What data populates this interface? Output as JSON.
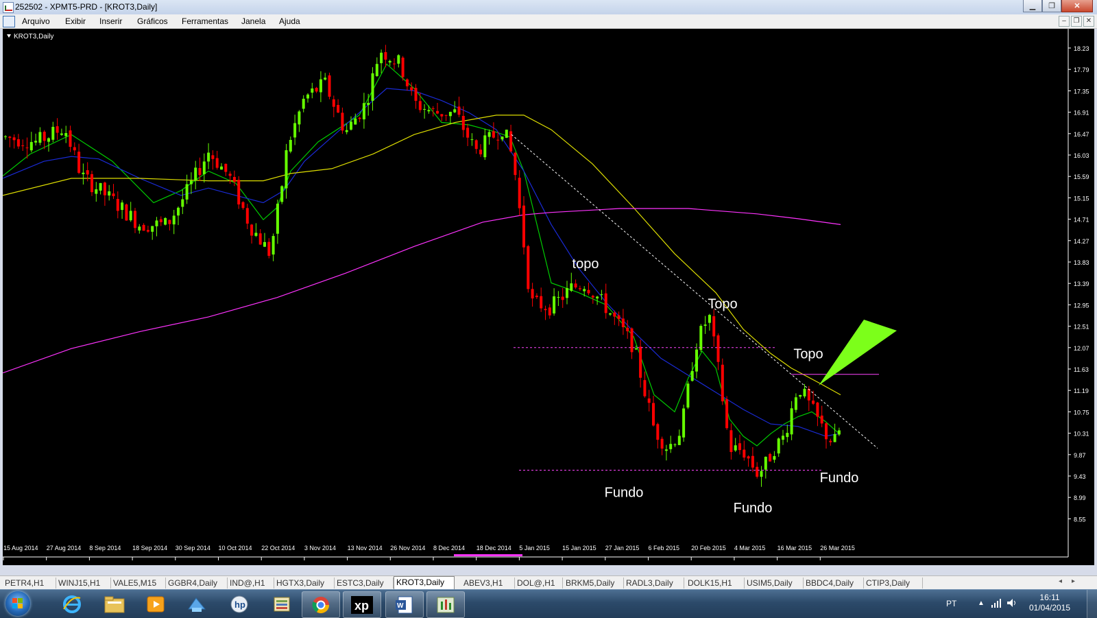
{
  "window": {
    "title": "252502 - XPMT5-PRD - [KROT3,Daily]"
  },
  "menu": {
    "items": [
      "Arquivo",
      "Exibir",
      "Inserir",
      "Gráficos",
      "Ferramentas",
      "Janela",
      "Ajuda"
    ]
  },
  "chart_panel": {
    "label": "KROT3,Daily"
  },
  "chart_data": {
    "type": "candlestick",
    "symbol": "KROT3",
    "timeframe": "Daily",
    "ylim": [
      8.33,
      18.45
    ],
    "price_ticks": [
      "18.23",
      "17.79",
      "17.35",
      "16.91",
      "16.47",
      "16.03",
      "15.59",
      "15.15",
      "14.71",
      "14.27",
      "13.83",
      "13.39",
      "12.95",
      "12.51",
      "12.07",
      "11.63",
      "11.19",
      "10.75",
      "10.31",
      "9.87",
      "9.43",
      "8.99",
      "8.55"
    ],
    "date_ticks": [
      "15 Aug 2014",
      "27 Aug 2014",
      "8 Sep 2014",
      "18 Sep 2014",
      "30 Sep 2014",
      "10 Oct 2014",
      "22 Oct 2014",
      "3 Nov 2014",
      "13 Nov 2014",
      "26 Nov 2014",
      "8 Dec 2014",
      "18 Dec 2014",
      "5 Jan 2015",
      "15 Jan 2015",
      "27 Jan 2015",
      "6 Feb 2015",
      "20 Feb 2015",
      "4 Mar 2015",
      "16 Mar 2015",
      "26 Mar 2015"
    ],
    "colors": {
      "background": "#000000",
      "up": "#66ff00",
      "down": "#ff0000",
      "ma_fast": "#00cc00",
      "ma_mid": "#1a2bd6",
      "ma_slow": "#dede00",
      "ma_long": "#ff33ff",
      "trend": "#ffffff",
      "support": "#ff44ff",
      "arrow": "#7cff1a"
    },
    "series": [
      {
        "name": "",
        "type": "moving_average",
        "color": "#00cc00",
        "x": [
          0,
          40,
          100,
          160,
          220,
          260,
          300,
          340,
          380,
          400,
          420,
          460,
          520,
          560,
          600,
          640,
          680,
          720,
          740,
          760,
          800,
          840,
          880,
          920,
          950,
          980,
          1000,
          1020,
          1040,
          1060,
          1080,
          1100,
          1120,
          1140,
          1160,
          1180,
          1200,
          1220
        ],
        "y": [
          15.6,
          16.05,
          16.45,
          15.9,
          15.05,
          15.3,
          15.7,
          15.45,
          14.7,
          14.95,
          15.7,
          16.3,
          16.85,
          17.9,
          17.4,
          16.7,
          16.65,
          16.5,
          16.4,
          15.7,
          13.4,
          13.2,
          12.95,
          12.3,
          11.1,
          10.75,
          11.45,
          12.0,
          11.65,
          10.6,
          10.25,
          10.05,
          10.3,
          10.5,
          10.65,
          10.75,
          10.55,
          10.3
        ]
      },
      {
        "name": "",
        "type": "moving_average",
        "color": "#1a2bd6",
        "x": [
          0,
          60,
          100,
          140,
          200,
          260,
          300,
          340,
          380,
          410,
          440,
          480,
          520,
          560,
          600,
          640,
          680,
          720,
          760,
          800,
          840,
          880,
          920,
          960,
          1000,
          1040,
          1080,
          1120,
          1160,
          1200,
          1220
        ],
        "y": [
          15.55,
          15.9,
          16.0,
          15.95,
          15.55,
          15.2,
          15.35,
          15.2,
          15.05,
          15.3,
          15.9,
          16.4,
          16.9,
          17.4,
          17.35,
          17.15,
          16.9,
          16.55,
          15.7,
          14.6,
          13.7,
          13.0,
          12.4,
          11.85,
          11.5,
          11.15,
          10.8,
          10.5,
          10.45,
          10.25,
          10.3
        ]
      },
      {
        "name": "",
        "type": "moving_average",
        "color": "#dede00",
        "x": [
          0,
          100,
          200,
          300,
          380,
          420,
          480,
          540,
          600,
          660,
          720,
          760,
          800,
          860,
          920,
          980,
          1040,
          1080,
          1120,
          1150,
          1190,
          1222
        ],
        "y": [
          15.2,
          15.55,
          15.55,
          15.5,
          15.5,
          15.65,
          15.75,
          16.05,
          16.45,
          16.7,
          16.85,
          16.85,
          16.55,
          15.85,
          14.95,
          14.0,
          13.2,
          12.45,
          11.95,
          11.65,
          11.35,
          11.1
        ]
      },
      {
        "name": "",
        "type": "moving_average",
        "color": "#ff33ff",
        "x": [
          0,
          100,
          200,
          300,
          400,
          500,
          600,
          700,
          760,
          800,
          900,
          1000,
          1100,
          1160,
          1222
        ],
        "y": [
          11.55,
          12.05,
          12.4,
          12.7,
          13.1,
          13.6,
          14.15,
          14.65,
          14.8,
          14.85,
          14.93,
          14.93,
          14.82,
          14.72,
          14.6
        ]
      }
    ],
    "candles_note": "Daily candles Aug 2014 – Mar 2015; ranged roughly 15.0–16.6 in Aug–Oct, rose to ~18.3 in late Nov, fell to ~12.9 in Jan, bottomed ~9.6–9.3 in Feb–Mar, last close ~10.6",
    "annotations": [
      {
        "text": "topo",
        "x": 850,
        "y": 13.7
      },
      {
        "text": "Topo",
        "x": 1050,
        "y": 12.88
      },
      {
        "text": "Topo",
        "x": 1175,
        "y": 11.85
      },
      {
        "text": "Fundo",
        "x": 906,
        "y": 9.0
      },
      {
        "text": "Fundo",
        "x": 1094,
        "y": 8.68
      },
      {
        "text": "Fundo",
        "x": 1220,
        "y": 9.3
      }
    ],
    "lines": [
      {
        "kind": "trendline",
        "color": "#ffffff",
        "style": "dotted",
        "from": [
          742,
          16.45
        ],
        "to": [
          1276,
          10.0
        ]
      },
      {
        "kind": "horizontal",
        "color": "#ff44ff",
        "style": "dotted",
        "price": 12.07,
        "from_x": 745,
        "to_x": 1128
      },
      {
        "kind": "horizontal",
        "color": "#ff44ff",
        "style": "dotted",
        "price": 9.55,
        "from_x": 753,
        "to_x": 1195
      },
      {
        "kind": "horizontal",
        "color": "#ff44ff",
        "style": "solid",
        "price": 11.52,
        "from_x": 1150,
        "to_x": 1278
      }
    ]
  },
  "tabs": {
    "items": [
      "PETR4,H1",
      "WINJ15,H1",
      "VALE5,M15",
      "GGBR4,Daily",
      "IND@,H1",
      "HGTX3,Daily",
      "ESTC3,Daily",
      "KROT3,Daily",
      "ABEV3,H1",
      "DOL@,H1",
      "BRKM5,Daily",
      "RADL3,Daily",
      "DOLK15,H1",
      "USIM5,Daily",
      "BBDC4,Daily",
      "CTIP3,Daily"
    ],
    "active": "KROT3,Daily"
  },
  "taskbar": {
    "apps": [
      "Internet Explorer",
      "Windows Explorer",
      "Media Player",
      "Network",
      "HP",
      "Archive",
      "Google Chrome",
      "XP Investimentos",
      "Microsoft Word",
      "MetaTrader"
    ],
    "tray_lang": "PT",
    "time": "16:11",
    "date": "01/04/2015"
  }
}
